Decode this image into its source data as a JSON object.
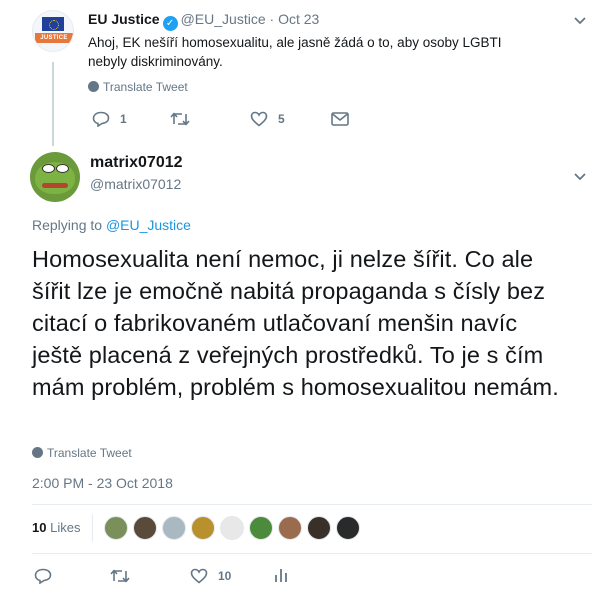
{
  "parent_tweet": {
    "avatar_text": "JUSTICE",
    "name": "EU Justice",
    "handle": "@EU_Justice",
    "separator": "·",
    "date": "Oct 23",
    "text": "Ahoj, EK nešíří homosexualitu, ale jasně žádá o to, aby osoby LGBTI nebyly diskriminovány.",
    "translate_label": "Translate Tweet",
    "reply_count": "1",
    "retweet_count": "",
    "like_count": "5"
  },
  "main_tweet": {
    "name": "matrix07012",
    "handle": "@matrix07012",
    "replying_label": "Replying to",
    "replying_to": "@EU_Justice",
    "text": "Homosexualita není nemoc, ji nelze šířit. Co ale šířit lze je emočně nabitá propaganda s čísly bez citací o fabrikovaném utlačovaní menšin navíc ještě placená z veřejných prostředků. To je s čím mám problém, problém s homosexualitou nemám.",
    "translate_label": "Translate Tweet",
    "timestamp": "2:00 PM - 23 Oct 2018",
    "likes_count": "10",
    "likes_label": "Likes",
    "like_action_count": "10"
  },
  "colors": {
    "accent": "#1da1f2",
    "link": "#1b95e0",
    "muted": "#657786",
    "text": "#14171a",
    "divider": "#e6ecf0"
  },
  "icons": {
    "verified": "verified-badge-icon",
    "translate": "globe-icon",
    "reply": "reply-icon",
    "retweet": "retweet-icon",
    "like": "heart-icon",
    "dm": "envelope-icon",
    "analytics": "analytics-icon",
    "more": "chevron-down-icon"
  }
}
